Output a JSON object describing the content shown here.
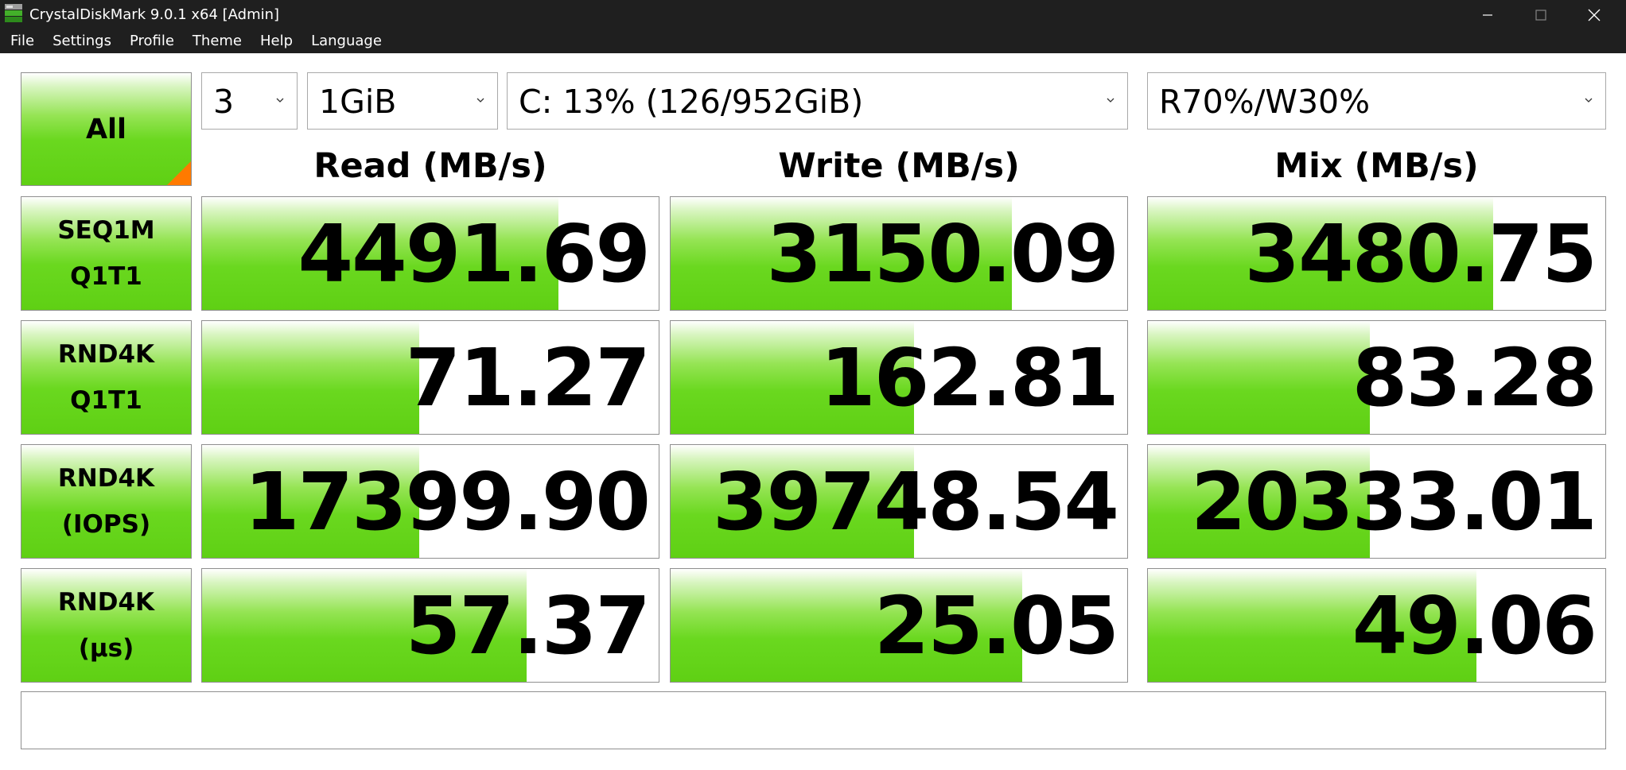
{
  "window": {
    "title": "CrystalDiskMark 9.0.1 x64 [Admin]"
  },
  "menu": [
    "File",
    "Settings",
    "Profile",
    "Theme",
    "Help",
    "Language"
  ],
  "controls": {
    "all_label": "All",
    "test_count": "3",
    "test_size": "1GiB",
    "drive": "C: 13% (126/952GiB)",
    "mix_ratio": "R70%/W30%"
  },
  "columns": {
    "read": "Read (MB/s)",
    "write": "Write (MB/s)",
    "mix": "Mix (MB/s)"
  },
  "rows": [
    {
      "label1": "SEQ1M",
      "label2": "Q1T1",
      "read": "4491.69",
      "write": "3150.09",
      "mix": "3480.75",
      "read_fill": 0.78,
      "write_fill": 0.748,
      "mix_fill": 0.755
    },
    {
      "label1": "RND4K",
      "label2": "Q1T1",
      "read": "71.27",
      "write": "162.81",
      "mix": "83.28",
      "read_fill": 0.475,
      "write_fill": 0.533,
      "mix_fill": 0.486
    },
    {
      "label1": "RND4K",
      "label2": "(IOPS)",
      "read": "17399.90",
      "write": "39748.54",
      "mix": "20333.01",
      "read_fill": 0.475,
      "write_fill": 0.533,
      "mix_fill": 0.486
    },
    {
      "label1": "RND4K",
      "label2": "(µs)",
      "read": "57.37",
      "write": "25.05",
      "mix": "49.06",
      "read_fill": 0.71,
      "write_fill": 0.77,
      "mix_fill": 0.718
    }
  ],
  "comment": "",
  "icons": {
    "app": "crystaldiskmark-app-icon",
    "minimize": "minimize-icon",
    "maximize": "maximize-icon",
    "close": "close-icon",
    "dropdown": "chevron-down-icon"
  },
  "colors": {
    "bar_green": "#5fd014",
    "corner_orange": "#ff7a00",
    "titlebar": "#1f1f1f"
  }
}
